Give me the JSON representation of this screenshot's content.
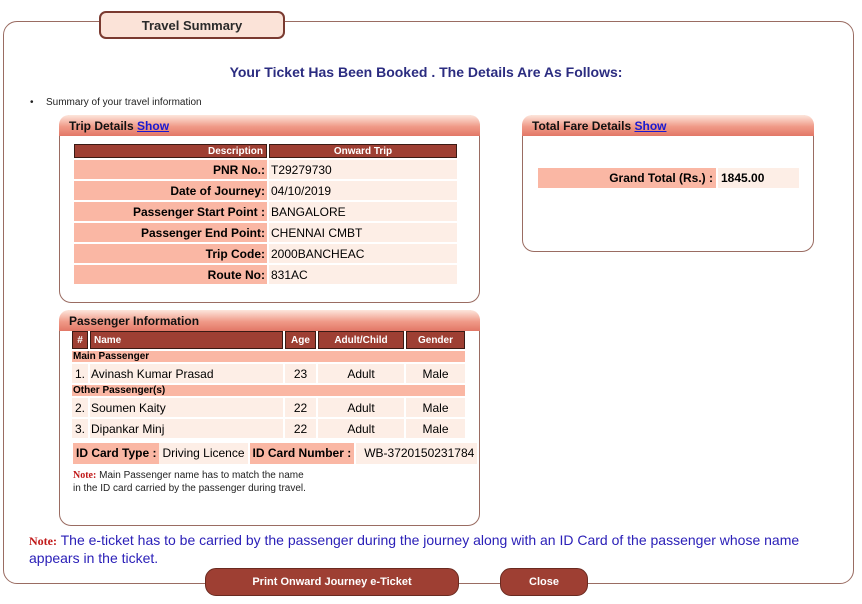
{
  "legend": "Travel Summary",
  "headline": "Your Ticket Has Been Booked . The Details Are As Follows:",
  "bullet": "Summary of your travel information",
  "trip": {
    "title": "Trip Details",
    "link": "Show",
    "headers": [
      "Description",
      "Onward Trip"
    ],
    "rows": [
      {
        "label": "PNR No.:",
        "value": "T29279730"
      },
      {
        "label": "Date of Journey:",
        "value": "04/10/2019"
      },
      {
        "label": "Passenger Start Point :",
        "value": "BANGALORE"
      },
      {
        "label": "Passenger End Point:",
        "value": "CHENNAI CMBT"
      },
      {
        "label": "Trip Code:",
        "value": "2000BANCHEAC"
      },
      {
        "label": "Route No:",
        "value": "831AC"
      }
    ]
  },
  "fare": {
    "title": "Total Fare Details",
    "link": "Show",
    "grand_label": "Grand Total (Rs.) :",
    "grand_value": "1845.00"
  },
  "passenger": {
    "title": "Passenger Information",
    "headers": {
      "num": "#",
      "name": "Name",
      "age": "Age",
      "type": "Adult/Child",
      "gender": "Gender"
    },
    "main_label": "Main Passenger",
    "other_label": "Other Passenger(s)",
    "main": [
      {
        "num": "1.",
        "name": "Avinash Kumar Prasad",
        "age": "23",
        "type": "Adult",
        "gender": "Male"
      }
    ],
    "others": [
      {
        "num": "2.",
        "name": "Soumen Kaity",
        "age": "22",
        "type": "Adult",
        "gender": "Male"
      },
      {
        "num": "3.",
        "name": "Dipankar Minj",
        "age": "22",
        "type": "Adult",
        "gender": "Male"
      }
    ],
    "id_type_label": "ID Card Type :",
    "id_type_value": "Driving Licence",
    "id_number_label": "ID Card Number :",
    "id_number_value": "WB-3720150231784",
    "note_label": "Note:",
    "note_line1": "Main Passenger name has to match the name",
    "note_line2": "in the ID card carried by the passenger during travel."
  },
  "footer_note": {
    "label": "Note:",
    "text": "The e-ticket has to be carried by the passenger during the journey along with an ID Card of the passenger whose name appears in the ticket."
  },
  "buttons": {
    "print": "Print Onward Journey e-Ticket",
    "close": "Close"
  },
  "colors": {
    "header_bg": "#9e3f33",
    "label_bg": "#fab7a4",
    "value_bg": "#fdeee6",
    "headline": "#2b2c80"
  }
}
